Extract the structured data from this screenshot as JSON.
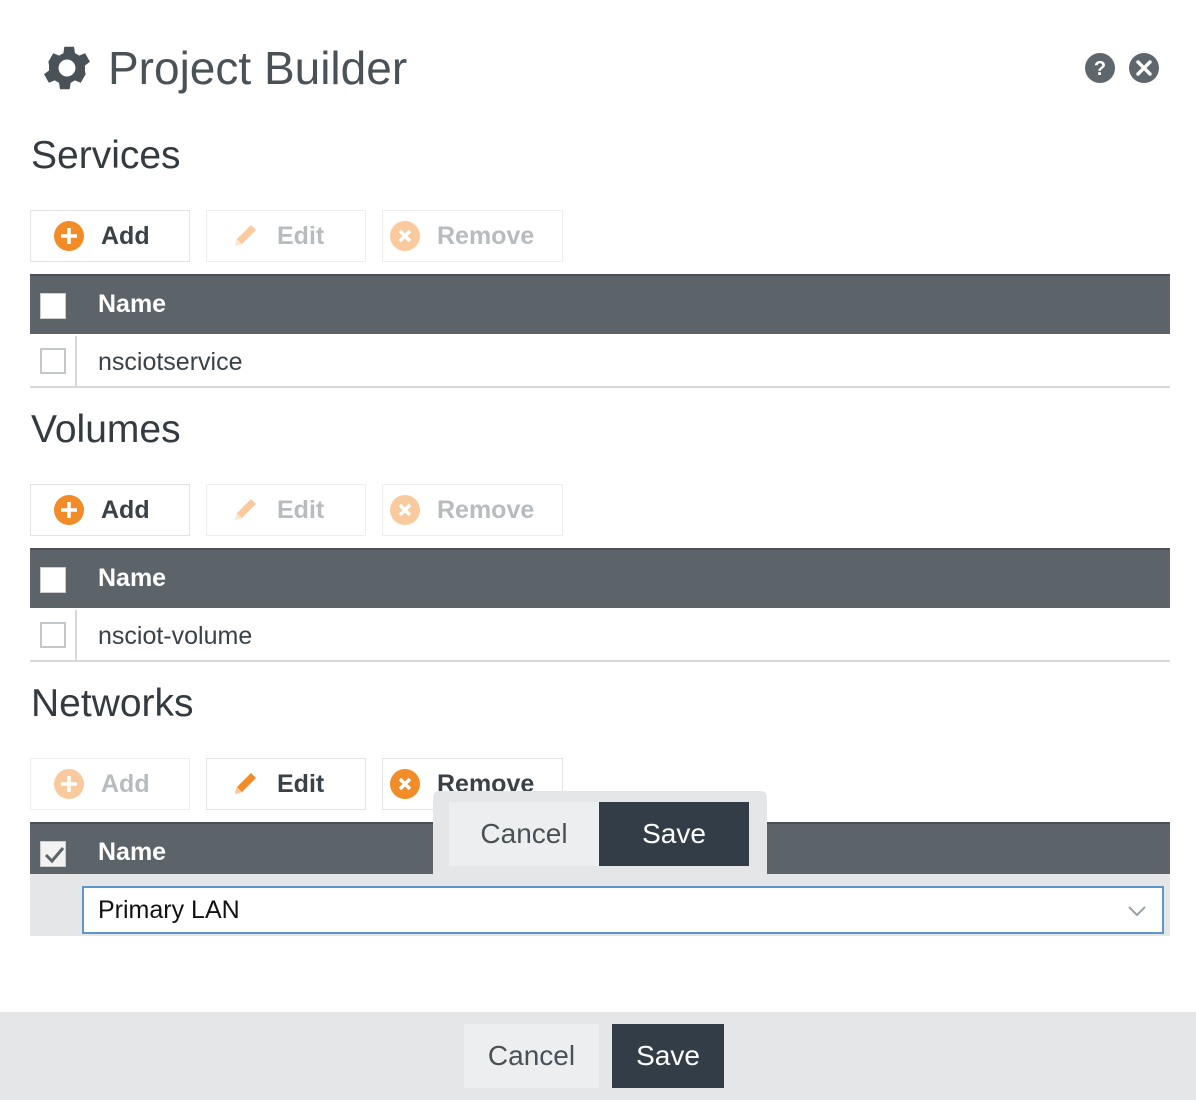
{
  "dialog": {
    "title": "Project Builder",
    "icons": {
      "title": "gear-icon",
      "help": "help-icon",
      "close": "close-icon"
    }
  },
  "colors": {
    "accent": "#f28c28",
    "header_bg": "#5c6369",
    "save_bg": "#333d47",
    "footer_bg": "#e4e6e8",
    "select_border": "#5d96c8"
  },
  "services": {
    "title": "Services",
    "toolbar": {
      "add": "Add",
      "edit": "Edit",
      "remove": "Remove"
    },
    "toolbar_state": {
      "add": "enabled",
      "edit": "disabled",
      "remove": "disabled"
    },
    "column": "Name",
    "rows": [
      {
        "name": "nsciotservice",
        "checked": false
      }
    ]
  },
  "volumes": {
    "title": "Volumes",
    "toolbar": {
      "add": "Add",
      "edit": "Edit",
      "remove": "Remove"
    },
    "toolbar_state": {
      "add": "enabled",
      "edit": "disabled",
      "remove": "disabled"
    },
    "column": "Name",
    "rows": [
      {
        "name": "nsciot-volume",
        "checked": false
      }
    ]
  },
  "networks": {
    "title": "Networks",
    "toolbar": {
      "add": "Add",
      "edit": "Edit",
      "remove": "Remove"
    },
    "toolbar_state": {
      "add": "disabled",
      "edit": "enabled",
      "remove": "enabled"
    },
    "column": "Name",
    "header_checked": true,
    "editor": {
      "selected": "Primary LAN"
    },
    "row_editor_buttons": {
      "cancel": "Cancel",
      "save": "Save"
    }
  },
  "footer": {
    "cancel": "Cancel",
    "save": "Save"
  }
}
